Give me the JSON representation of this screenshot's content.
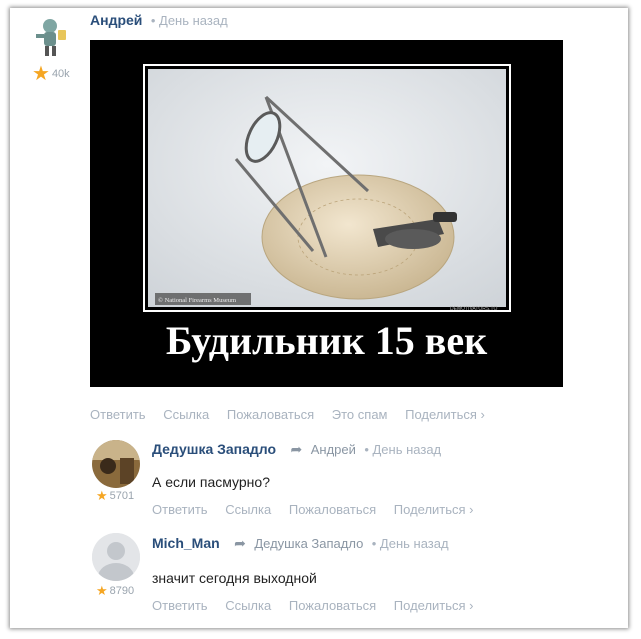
{
  "post": {
    "author": "Андрей",
    "time": "• День назад",
    "karma": "40k",
    "image_caption": "Будильник 15 век",
    "watermark_left": "© National Firearms Museum",
    "watermark_right": "DEMOTIVATORS.TO",
    "actions": [
      "Ответить",
      "Ссылка",
      "Пожаловаться",
      "Это спам",
      "Поделиться ›"
    ]
  },
  "comments": [
    {
      "author": "Дедушка Западло",
      "reply_to": "Андрей",
      "time": "• День назад",
      "text": "А если пасмурно?",
      "karma": "5701",
      "actions": [
        "Ответить",
        "Ссылка",
        "Пожаловаться",
        "Поделиться ›"
      ]
    },
    {
      "author": "Mich_Man",
      "reply_to": "Дедушка Западло",
      "time": "• День назад",
      "text": "значит сегодня выходной",
      "karma": "8790",
      "actions": [
        "Ответить",
        "Ссылка",
        "Пожаловаться",
        "Поделиться ›"
      ]
    }
  ],
  "colors": {
    "author": "#2a4e7a",
    "muted": "#a9b3bf",
    "star": "#f5a623",
    "demotivator_bg": "#000000"
  },
  "icons": [
    "star-icon",
    "reply-arrow-icon"
  ]
}
